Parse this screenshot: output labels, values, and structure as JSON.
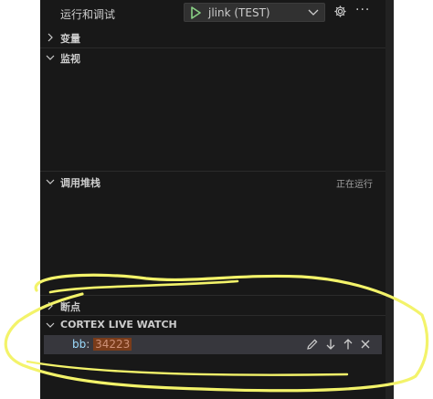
{
  "header": {
    "title": "运行和调试",
    "config_name": "jlink (TEST)",
    "icons": [
      "run-icon",
      "chevron-down-icon",
      "gear-icon",
      "more-icon"
    ]
  },
  "sections": {
    "variables": "变量",
    "watch": "监视",
    "call_stack": "调用堆栈",
    "call_stack_status": "正在运行",
    "breakpoints": "断点",
    "live_watch": "CORTEX LIVE WATCH"
  },
  "live_watch_item": {
    "name": "bb",
    "separator": ":",
    "value": "34223",
    "actions": [
      "edit-icon",
      "move-down-icon",
      "move-up-icon",
      "remove-icon"
    ]
  },
  "colors": {
    "panel_bg": "#181818",
    "annotation": "#f3f36a",
    "run_green": "#89d185"
  }
}
